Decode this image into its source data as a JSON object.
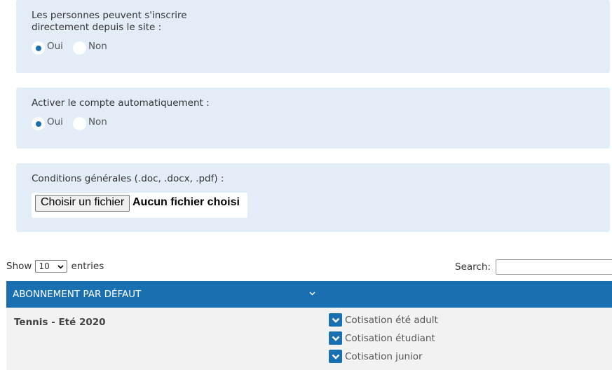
{
  "signup": {
    "label_line1": "Les personnes peuvent s'inscrire",
    "label_line2": "directement depuis le site :",
    "yes": "Oui",
    "no": "Non"
  },
  "autoactivate": {
    "label": "Activer le compte automatiquement :",
    "yes": "Oui",
    "no": "Non"
  },
  "terms": {
    "label": "Conditions générales (.doc, .docx, .pdf) :",
    "button": "Choisir un fichier",
    "status": "Aucun fichier choisi"
  },
  "table_controls": {
    "show": "Show",
    "page_size": "10",
    "entries": "entries",
    "search_label": "Search:"
  },
  "table": {
    "header": "ABONNEMENT PAR DÉFAUT",
    "rows": [
      {
        "name": "Tennis - Eté 2020",
        "options": [
          "Cotisation été adult",
          "Cotisation étudiant",
          "Cotisation junior"
        ]
      }
    ]
  },
  "colors": {
    "accent": "#1a6fb0",
    "panel": "#e3edf7"
  }
}
